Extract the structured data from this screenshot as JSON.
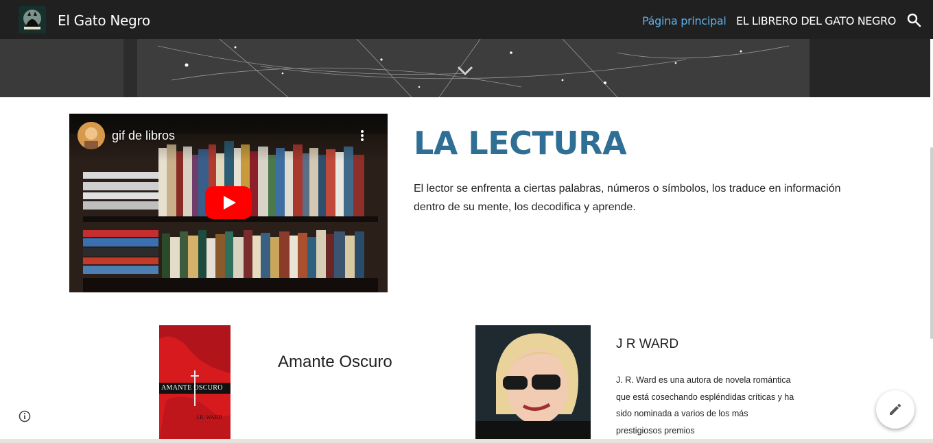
{
  "header": {
    "site_title": "El Gato Negro",
    "nav": [
      {
        "label": "Página principal",
        "active": true
      },
      {
        "label": "EL LIBRERO DEL GATO NEGRO",
        "active": false
      }
    ],
    "icons": {
      "logo": "cat-logo-icon",
      "search": "search-icon"
    }
  },
  "banner": {
    "icon": "chevron-down-icon"
  },
  "video": {
    "title": "gif de libros",
    "icons": {
      "play": "youtube-play-icon",
      "menu": "more-vert-icon",
      "channel": "channel-avatar"
    }
  },
  "section": {
    "heading": "LA LECTURA",
    "paragraph": "El lector se enfrenta a ciertas palabras, números o símbolos, los traduce en información dentro de su mente, los decodifica y aprende."
  },
  "book": {
    "title": "Amante Oscuro",
    "cover_title": "AMANTE OSCURO",
    "cover_author": "J.R. WARD"
  },
  "author": {
    "name": "J R WARD",
    "bio": "J. R. Ward es una autora de novela romántica que está cosechando espléndidas críticas y ha sido nominada a varios de los más prestigiosos premios"
  },
  "controls": {
    "info": "info-icon",
    "edit": "pencil-icon"
  },
  "colors": {
    "accent": "#2f6f96",
    "nav_active": "#5fb0e8",
    "topbar": "#202020",
    "youtube_red": "#ff0000"
  }
}
